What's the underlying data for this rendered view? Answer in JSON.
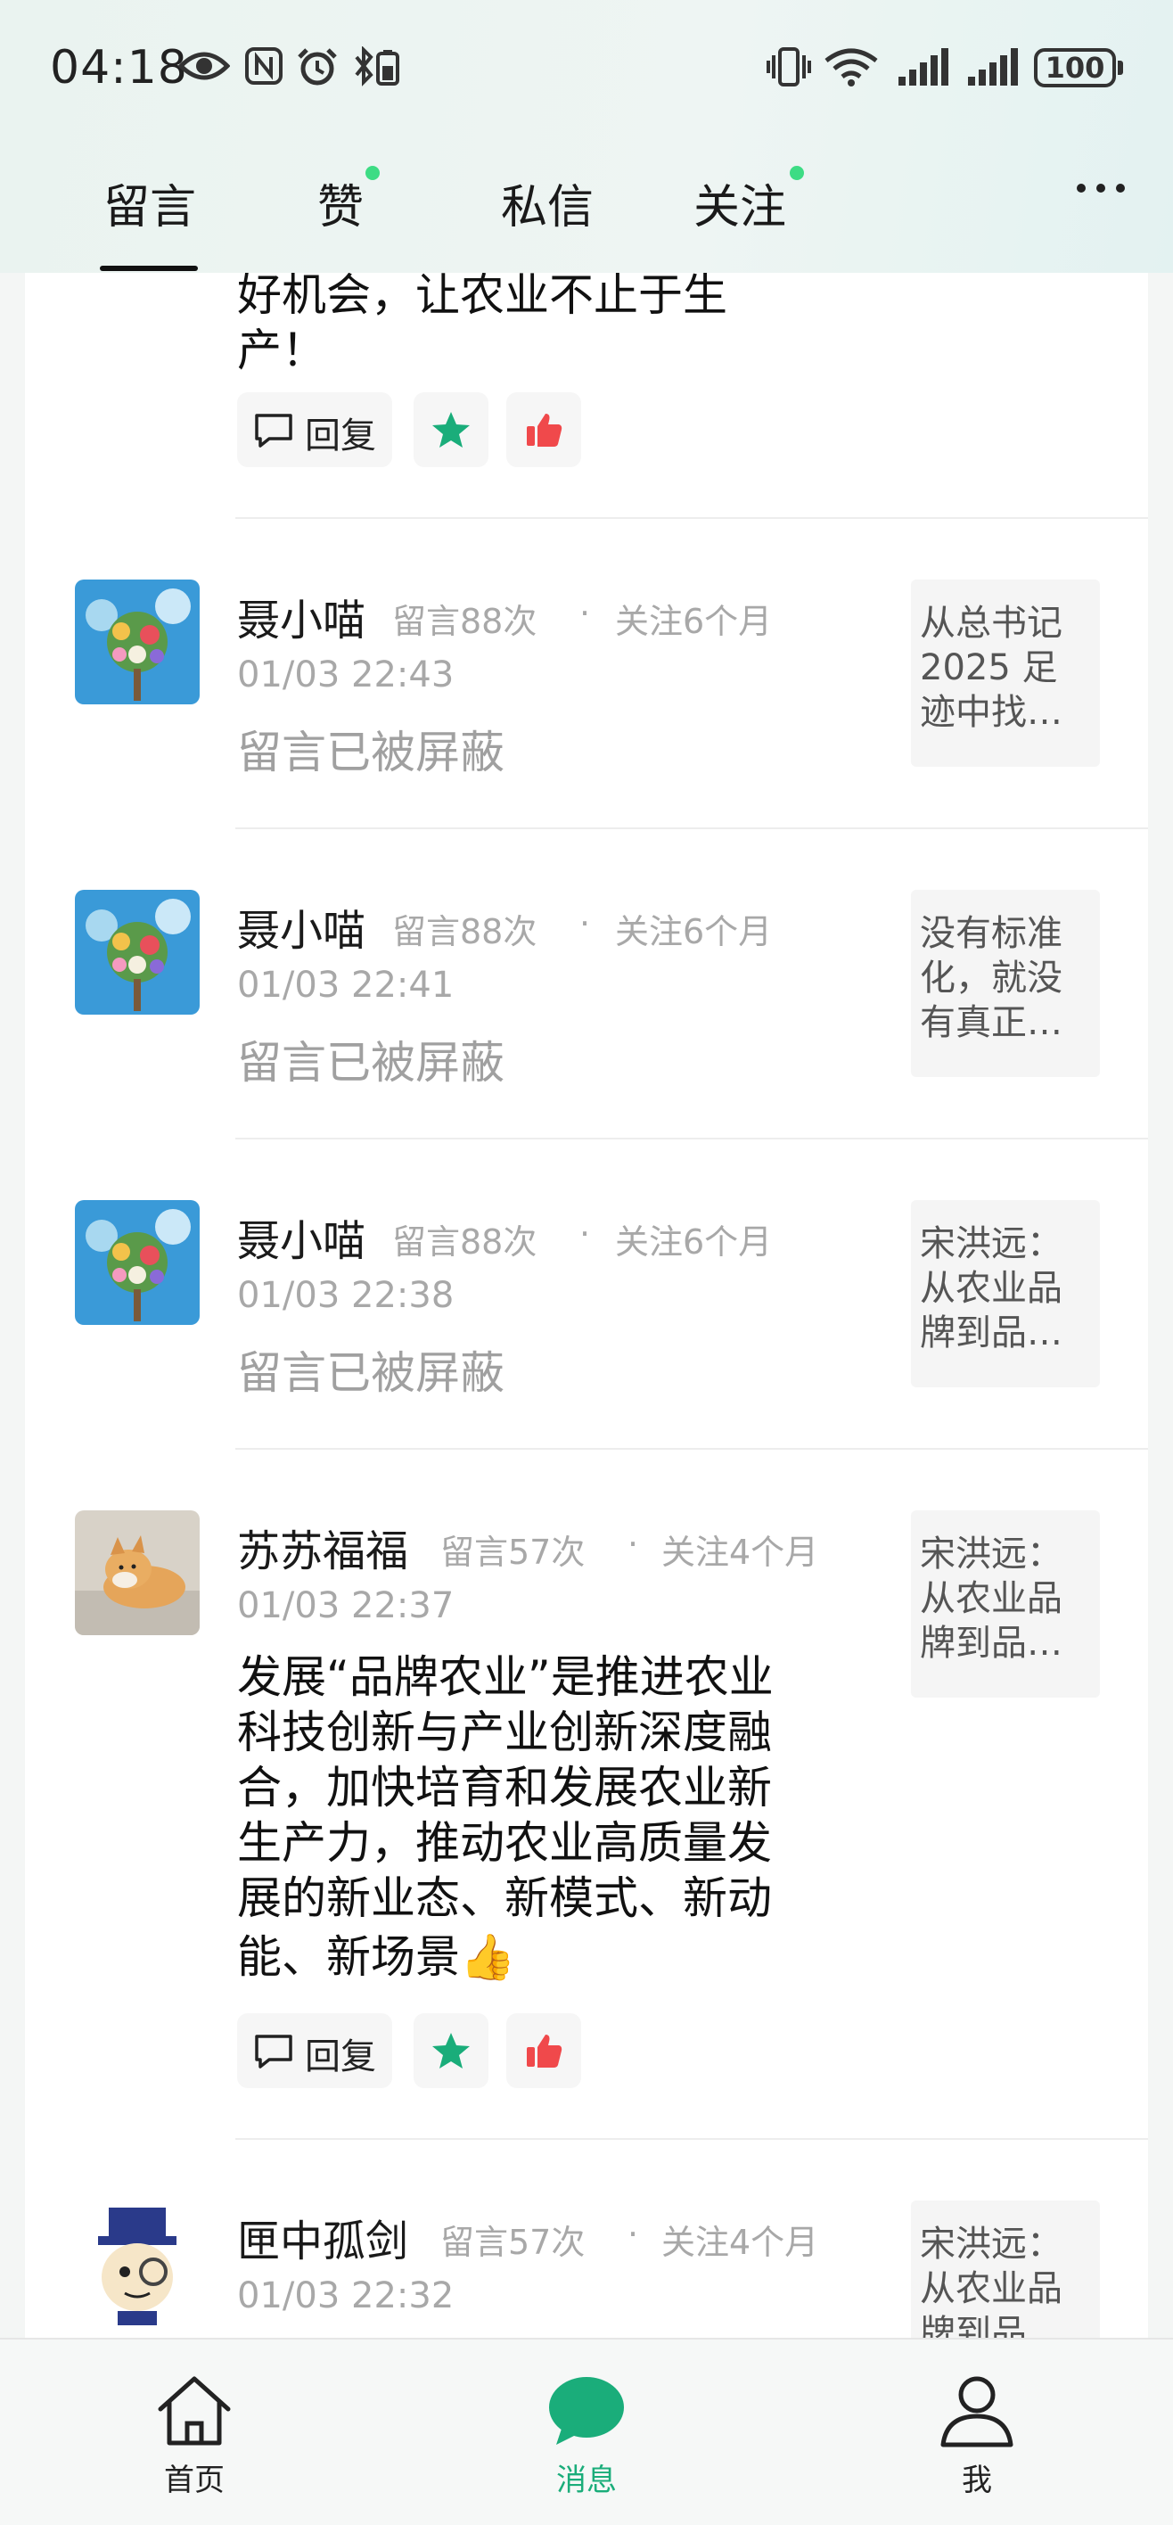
{
  "status_bar": {
    "time": "04:18",
    "battery": "100"
  },
  "tabs": [
    {
      "label": "留言",
      "active": true,
      "has_dot": false
    },
    {
      "label": "赞",
      "active": false,
      "has_dot": true
    },
    {
      "label": "私信",
      "active": false,
      "has_dot": false
    },
    {
      "label": "关注",
      "active": false,
      "has_dot": true
    }
  ],
  "colors": {
    "accent": "#1aad7a",
    "dot": "#3ddc84",
    "like": "#f0494b"
  },
  "messages": [
    {
      "partial_text": "好机会，让农业不止于生产！",
      "partial_line1": "好机会，让农业不止于生",
      "partial_line2": "产！",
      "reply_label": "回复"
    },
    {
      "name": "聂小喵",
      "count": "留言88次",
      "follow": "关注6个月",
      "time": "01/03 22:43",
      "status": "留言已被屏蔽",
      "article": "从总书记2025 足迹中找…",
      "article_lines": [
        "从总书记",
        "2025 足",
        "迹中找…"
      ]
    },
    {
      "name": "聂小喵",
      "count": "留言88次",
      "follow": "关注6个月",
      "time": "01/03 22:41",
      "status": "留言已被屏蔽",
      "article": "没有标准化，就没有真正…",
      "article_lines": [
        "没有标准",
        "化，就没",
        "有真正…"
      ]
    },
    {
      "name": "聂小喵",
      "count": "留言88次",
      "follow": "关注6个月",
      "time": "01/03 22:38",
      "status": "留言已被屏蔽",
      "article": "宋洪远：从农业品牌到品…",
      "article_lines": [
        "宋洪远：",
        "从农业品",
        "牌到品…"
      ]
    },
    {
      "name": "苏苏福福",
      "count": "留言57次",
      "follow": "关注4个月",
      "time": "01/03 22:37",
      "text_lines": [
        "发展“品牌农业”是推进农业",
        "科技创新与产业创新深度融",
        "合，加快培育和发展农业新",
        "生产力，推动农业高质量发",
        "展的新业态、新模式、新动",
        "能、新场景"
      ],
      "text_emoji": "👍",
      "article": "宋洪远：从农业品牌到品…",
      "article_lines": [
        "宋洪远：",
        "从农业品",
        "牌到品…"
      ],
      "reply_label": "回复"
    },
    {
      "name": "匣中孤剑",
      "count": "留言57次",
      "follow": "关注4个月",
      "time": "01/03 22:32",
      "article": "宋洪远：从农业品牌到品",
      "article_lines": [
        "宋洪远：",
        "从农业品",
        "牌到品"
      ]
    }
  ],
  "bottom_nav": [
    {
      "label": "首页",
      "icon": "home-icon",
      "active": false
    },
    {
      "label": "消息",
      "icon": "chat-bubble-icon",
      "active": true
    },
    {
      "label": "我",
      "icon": "person-icon",
      "active": false
    }
  ]
}
